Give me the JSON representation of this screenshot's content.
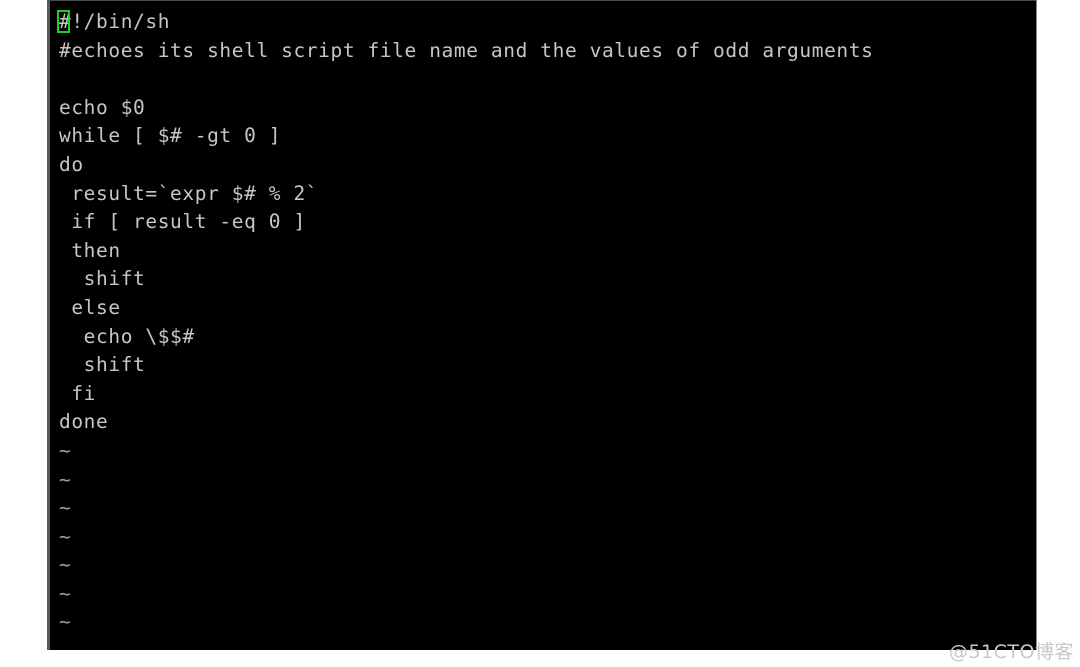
{
  "terminal": {
    "editor": "vim",
    "background_color": "#000000",
    "text_color": "#c6c6c6",
    "cursor_color": "#22cc22",
    "tilde_color": "#8ea2b8",
    "cursor": {
      "line": 1,
      "column": 1,
      "character": "#"
    },
    "lines": [
      {
        "id": 1,
        "type": "code",
        "prefix": "#",
        "text": "!/bin/sh",
        "cursor": true
      },
      {
        "id": 2,
        "type": "code",
        "text": "#echoes its shell script file name and the values of odd arguments"
      },
      {
        "id": 3,
        "type": "code",
        "text": ""
      },
      {
        "id": 4,
        "type": "code",
        "text": "echo $0"
      },
      {
        "id": 5,
        "type": "code",
        "text": "while [ $# -gt 0 ]"
      },
      {
        "id": 6,
        "type": "code",
        "text": "do"
      },
      {
        "id": 7,
        "type": "code",
        "text": " result=`expr $# % 2`"
      },
      {
        "id": 8,
        "type": "code",
        "text": " if [ result -eq 0 ]"
      },
      {
        "id": 9,
        "type": "code",
        "text": " then"
      },
      {
        "id": 10,
        "type": "code",
        "text": "  shift"
      },
      {
        "id": 11,
        "type": "code",
        "text": " else"
      },
      {
        "id": 12,
        "type": "code",
        "text": "  echo \\$$#"
      },
      {
        "id": 13,
        "type": "code",
        "text": "  shift"
      },
      {
        "id": 14,
        "type": "code",
        "text": " fi"
      },
      {
        "id": 15,
        "type": "code",
        "text": "done"
      },
      {
        "id": 16,
        "type": "tilde",
        "text": "~"
      },
      {
        "id": 17,
        "type": "tilde",
        "text": "~"
      },
      {
        "id": 18,
        "type": "tilde",
        "text": "~"
      },
      {
        "id": 19,
        "type": "tilde",
        "text": "~"
      },
      {
        "id": 20,
        "type": "tilde",
        "text": "~"
      },
      {
        "id": 21,
        "type": "tilde",
        "text": "~"
      },
      {
        "id": 22,
        "type": "tilde",
        "text": "~"
      },
      {
        "id": 23,
        "type": "tilde",
        "text": "~"
      }
    ]
  },
  "watermark": {
    "text": "@51CTO博客"
  }
}
